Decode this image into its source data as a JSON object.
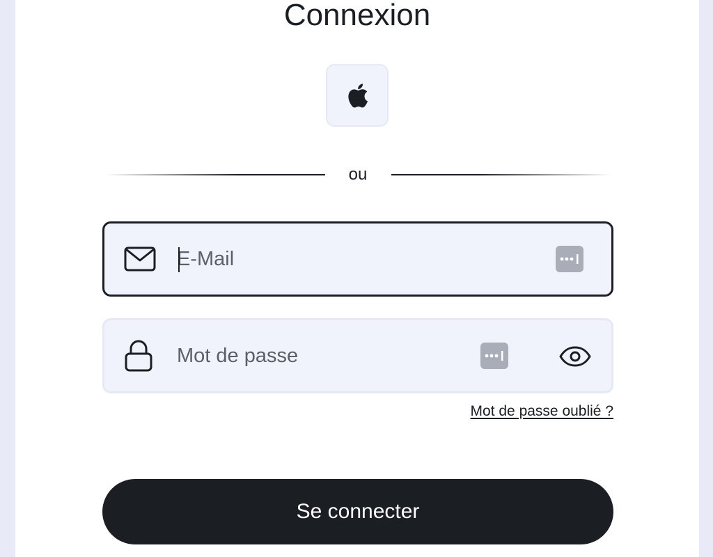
{
  "header": {
    "title": "Connexion"
  },
  "social": {
    "apple_icon": "apple-logo-icon"
  },
  "divider": {
    "text": "ou"
  },
  "email_field": {
    "placeholder": "E-Mail",
    "value": "",
    "lead_icon": "envelope-icon",
    "trailing_icon": "password-manager-icon"
  },
  "password_field": {
    "placeholder": "Mot de passe",
    "value": "",
    "lead_icon": "lock-icon",
    "trailing_icons": [
      "password-manager-icon",
      "eye-icon"
    ]
  },
  "links": {
    "forgot_password": "Mot de passe oublié ?"
  },
  "actions": {
    "submit_label": "Se connecter"
  },
  "colors": {
    "page_background": "#e8ebf7",
    "card_background": "#ffffff",
    "field_background": "#f1f3fc",
    "primary_dark": "#1b1f24",
    "icon_grey": "#a9adb7"
  }
}
